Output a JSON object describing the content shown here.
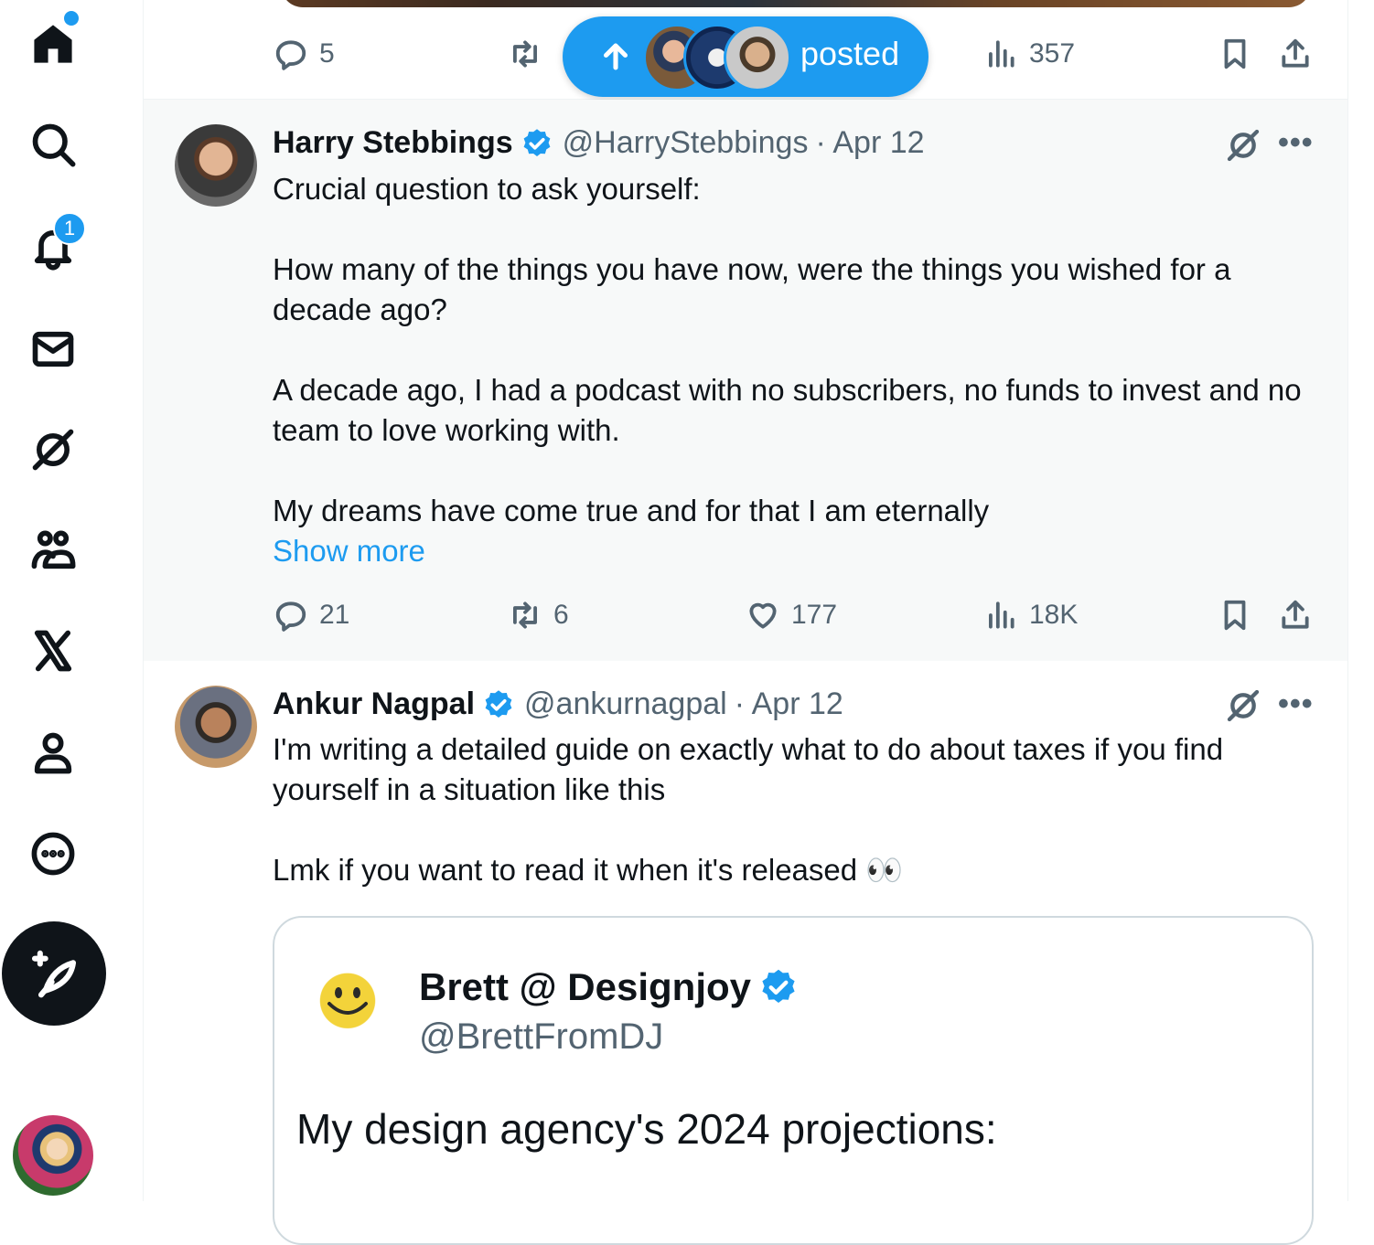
{
  "sidebar": {
    "items": [
      {
        "icon": "home-icon"
      },
      {
        "icon": "search-icon"
      },
      {
        "icon": "bell-icon",
        "badge": "1"
      },
      {
        "icon": "mail-icon"
      },
      {
        "icon": "grok-icon"
      },
      {
        "icon": "communities-icon"
      },
      {
        "icon": "x-logo-icon"
      },
      {
        "icon": "profile-icon"
      },
      {
        "icon": "more-circle-icon"
      }
    ],
    "post_button_icon": "feather-plus-icon"
  },
  "top_tweet_actions": {
    "replies": "5",
    "views": "357"
  },
  "posted_pill": {
    "label": "posted",
    "icon": "arrow-up-icon"
  },
  "tweets": [
    {
      "name": "Harry Stebbings",
      "handle": "@HarryStebbings",
      "date": "· Apr 12",
      "lines": [
        "Crucial question to ask yourself:",
        "How many of the things you have now, were the things you wished for a decade ago?",
        "A decade ago, I had a podcast with no subscribers, no funds to invest and no team to love working with.",
        "My dreams have come true and for that I am eternally"
      ],
      "show_more": "Show more",
      "replies": "21",
      "reposts": "6",
      "likes": "177",
      "views": "18K"
    },
    {
      "name": "Ankur Nagpal",
      "handle": "@ankurnagpal",
      "date": "· Apr 12",
      "lines": [
        "I'm writing a detailed guide on exactly what to do about taxes if you find yourself in a situation like this",
        "Lmk if you want to read it when it's released 👀"
      ],
      "quote": {
        "name": "Brett @ Designjoy",
        "handle": "@BrettFromDJ",
        "text": "My design agency's 2024 projections:"
      }
    }
  ],
  "colors": {
    "accent": "#1d9bf0",
    "text": "#0f1419",
    "muted": "#536471",
    "hover_bg": "#f7f9f9"
  }
}
